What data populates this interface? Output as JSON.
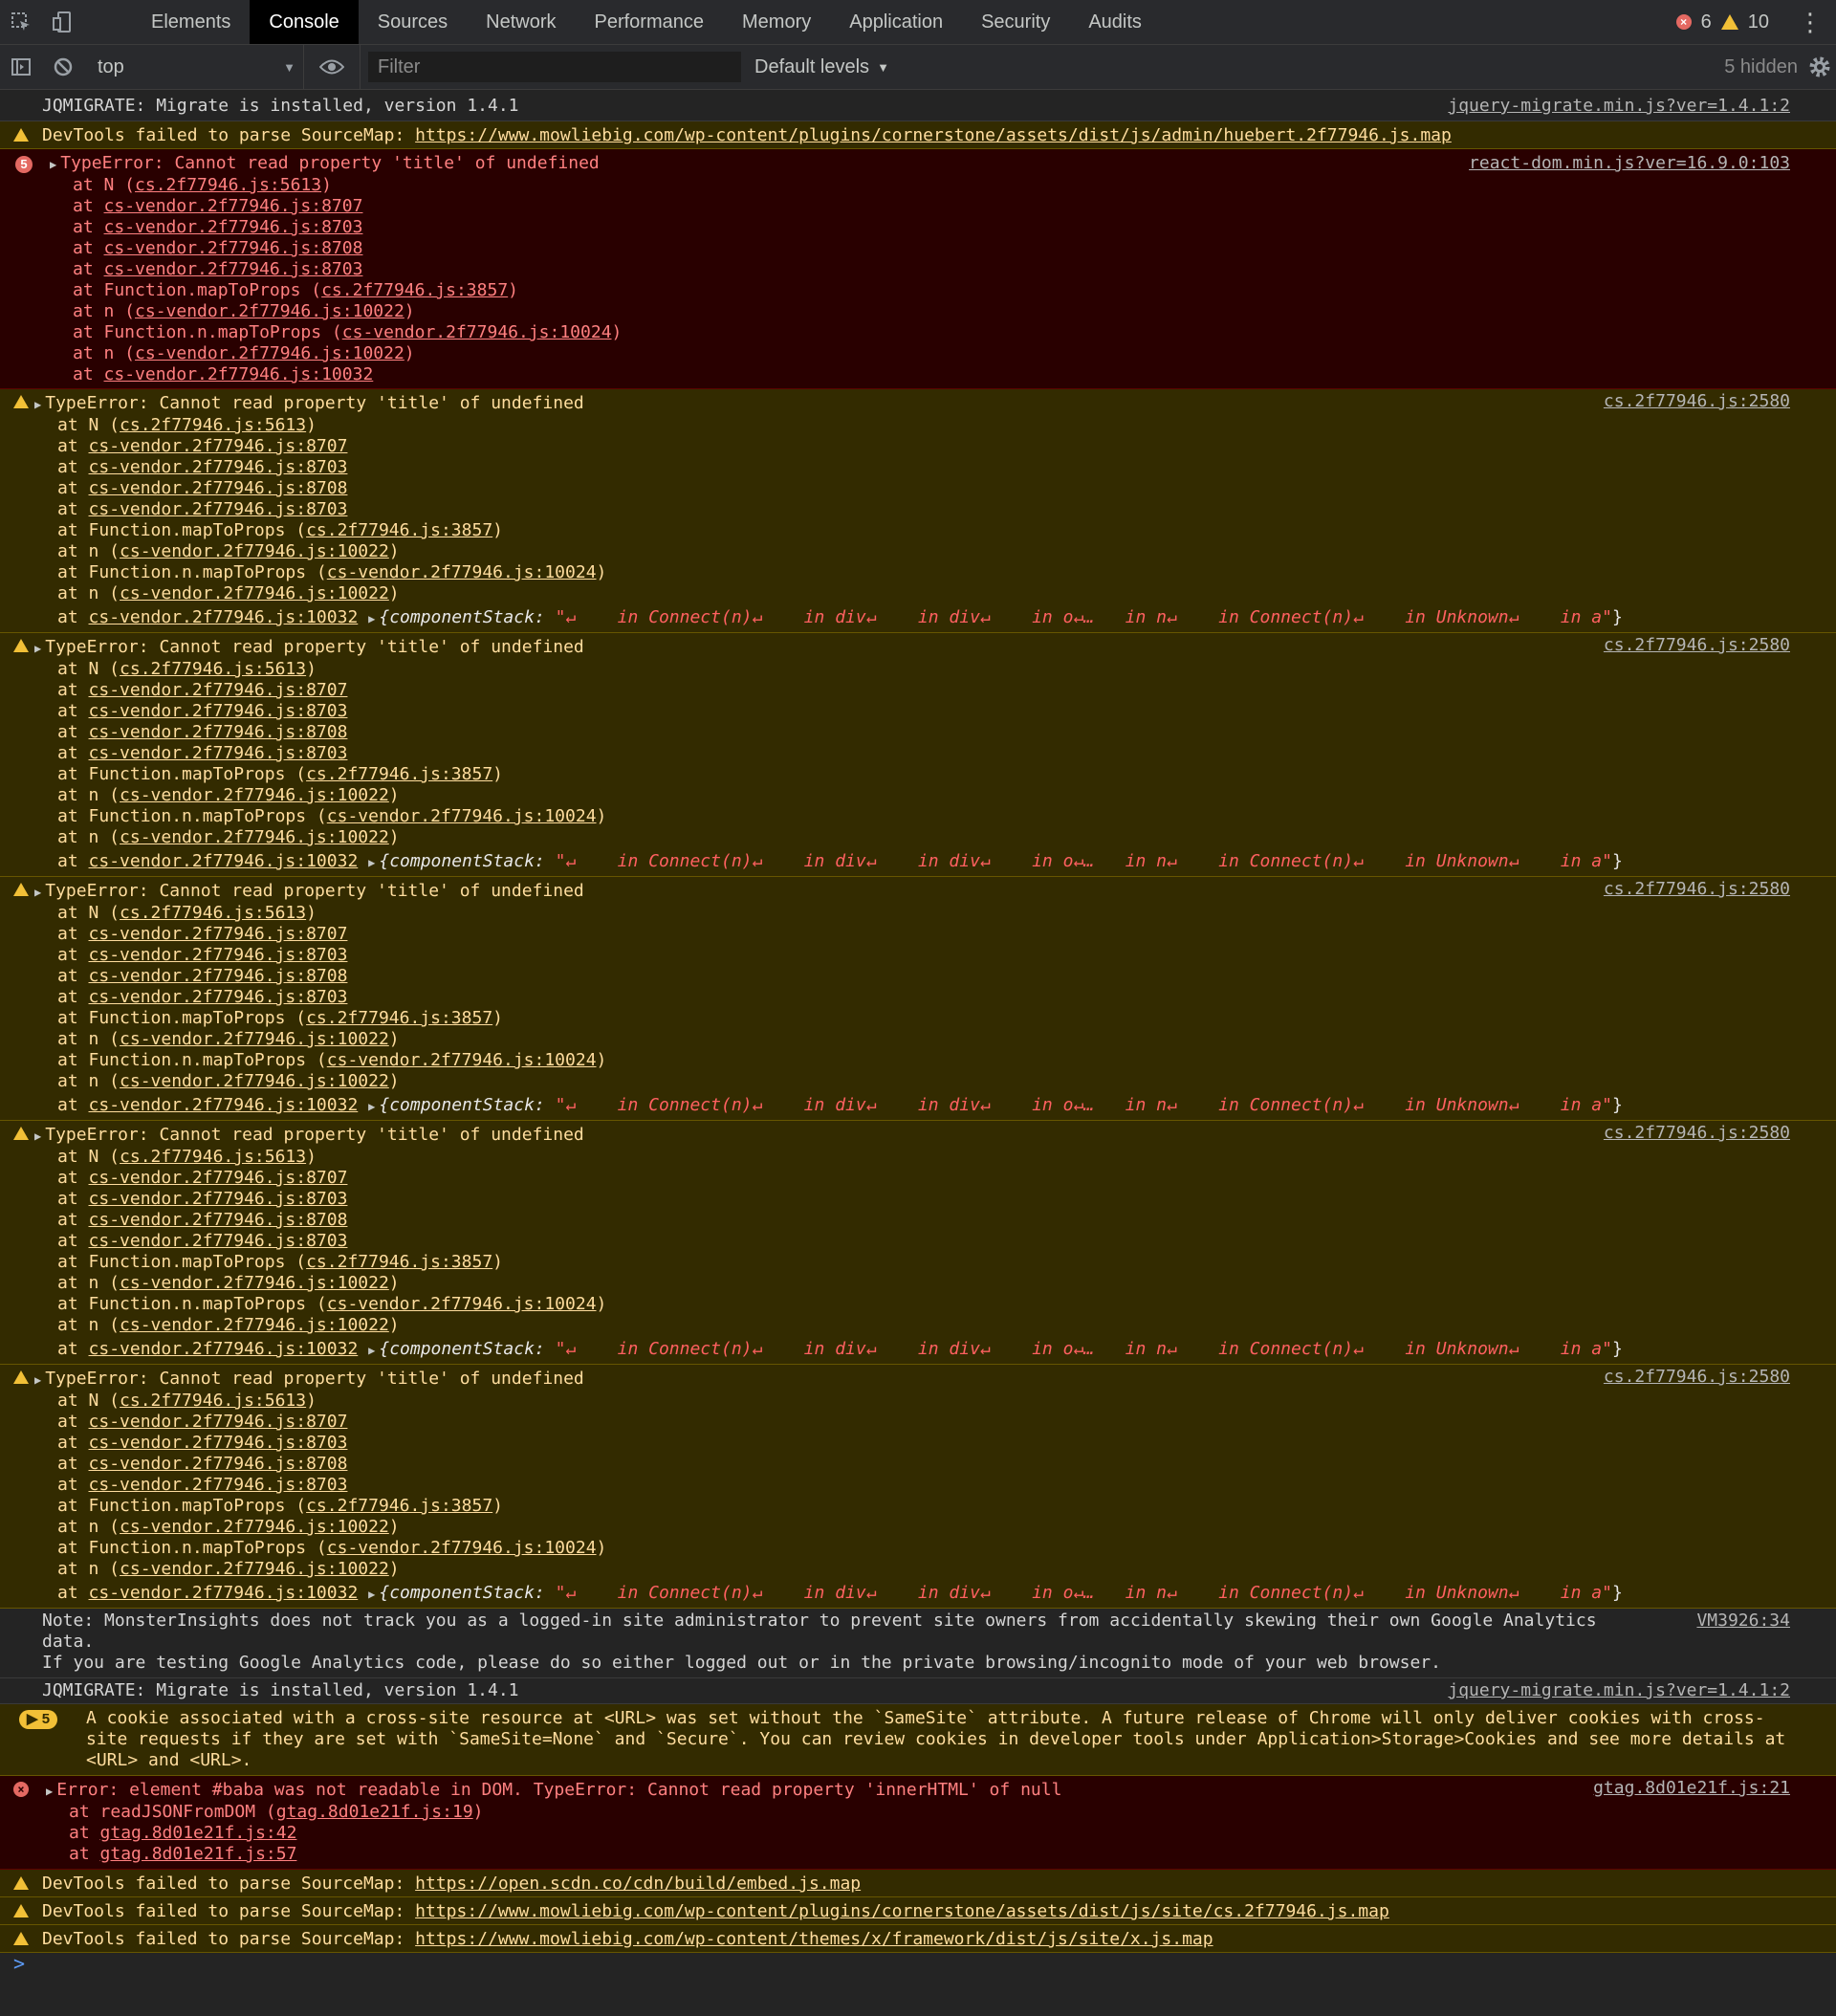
{
  "tabs": [
    "Elements",
    "Console",
    "Sources",
    "Network",
    "Performance",
    "Memory",
    "Application",
    "Security",
    "Audits"
  ],
  "counts": {
    "errors": "6",
    "warnings": "10"
  },
  "toolbar": {
    "context": "top",
    "filter_placeholder": "Filter",
    "levels": "Default levels",
    "hidden": "5 hidden"
  },
  "colors": {
    "warn_bg": "#332b00",
    "error_bg": "#290000",
    "error_text": "#ff8080",
    "warn_text": "#ffdd9e",
    "accent": "#f2c037"
  },
  "messages": {
    "m1": {
      "text": "JQMIGRATE: Migrate is installed, version 1.4.1",
      "src": "jquery-migrate.min.js?ver=1.4.1:2"
    },
    "m2": {
      "text": "DevTools failed to parse SourceMap: ",
      "url": "https://www.mowliebig.com/wp-content/plugins/cornerstone/assets/dist/js/admin/huebert.2f77946.js.map"
    },
    "m3": {
      "badge": "5",
      "text": "TypeError: Cannot read property 'title' of undefined",
      "src": "react-dom.min.js?ver=16.9.0:103",
      "frames": [
        [
          "at N (",
          "cs.2f77946.js:5613",
          ")"
        ],
        [
          "at ",
          "cs-vendor.2f77946.js:8707",
          ""
        ],
        [
          "at ",
          "cs-vendor.2f77946.js:8703",
          ""
        ],
        [
          "at ",
          "cs-vendor.2f77946.js:8708",
          ""
        ],
        [
          "at ",
          "cs-vendor.2f77946.js:8703",
          ""
        ],
        [
          "at Function.mapToProps (",
          "cs.2f77946.js:3857",
          ")"
        ],
        [
          "at n (",
          "cs-vendor.2f77946.js:10022",
          ")"
        ],
        [
          "at Function.n.mapToProps (",
          "cs-vendor.2f77946.js:10024",
          ")"
        ],
        [
          "at n (",
          "cs-vendor.2f77946.js:10022",
          ")"
        ],
        [
          "at ",
          "cs-vendor.2f77946.js:10032",
          ""
        ]
      ]
    },
    "warn_block": {
      "text": "TypeError: Cannot read property 'title' of undefined",
      "src": "cs.2f77946.js:2580",
      "frames": [
        [
          "at N (",
          "cs.2f77946.js:5613",
          ")"
        ],
        [
          "at ",
          "cs-vendor.2f77946.js:8707",
          ""
        ],
        [
          "at ",
          "cs-vendor.2f77946.js:8703",
          ""
        ],
        [
          "at ",
          "cs-vendor.2f77946.js:8708",
          ""
        ],
        [
          "at ",
          "cs-vendor.2f77946.js:8703",
          ""
        ],
        [
          "at Function.mapToProps (",
          "cs.2f77946.js:3857",
          ")"
        ],
        [
          "at n (",
          "cs-vendor.2f77946.js:10022",
          ")"
        ],
        [
          "at Function.n.mapToProps (",
          "cs-vendor.2f77946.js:10024",
          ")"
        ],
        [
          "at n (",
          "cs-vendor.2f77946.js:10022",
          ")"
        ]
      ],
      "last_prefix": "at ",
      "last_link": "cs-vendor.2f77946.js:10032",
      "cs_key": "{componentStack: ",
      "cs_value": "\"↵    in Connect(n)↵    in div↵    in div↵    in o↵…   in n↵    in Connect(n)↵    in Unknown↵    in a\"",
      "cs_close": "}"
    },
    "note": {
      "line1": "Note: MonsterInsights does not track you as a logged-in site administrator to prevent site owners from accidentally skewing their own Google Analytics data.",
      "line2": "If you are testing Google Analytics code, please do so either logged out or in the private browsing/incognito mode of your web browser.",
      "src": "VM3926:34"
    },
    "m_jq2": {
      "text": "JQMIGRATE: Migrate is installed, version 1.4.1",
      "src": "jquery-migrate.min.js?ver=1.4.1:2"
    },
    "cookie": {
      "badge": "5",
      "text": "A cookie associated with a cross-site resource at <URL> was set without the `SameSite` attribute. A future release of Chrome will only deliver cookies with cross-site requests if they are set with `SameSite=None` and `Secure`. You can review cookies in developer tools under Application>Storage>Cookies and see more details at <URL> and <URL>."
    },
    "gtag": {
      "text": "Error: element #baba was not readable in DOM. TypeError: Cannot read property 'innerHTML' of null",
      "src": "gtag.8d01e21f.js:21",
      "frames": [
        [
          "at readJSONFromDOM (",
          "gtag.8d01e21f.js:19",
          ")"
        ],
        [
          "at ",
          "gtag.8d01e21f.js:42",
          ""
        ],
        [
          "at ",
          "gtag.8d01e21f.js:57",
          ""
        ]
      ]
    },
    "sm1": {
      "text": "DevTools failed to parse SourceMap: ",
      "url": "https://open.scdn.co/cdn/build/embed.js.map"
    },
    "sm2": {
      "text": "DevTools failed to parse SourceMap: ",
      "url": "https://www.mowliebig.com/wp-content/plugins/cornerstone/assets/dist/js/site/cs.2f77946.js.map"
    },
    "sm3": {
      "text": "DevTools failed to parse SourceMap: ",
      "url": "https://www.mowliebig.com/wp-content/themes/x/framework/dist/js/site/x.js.map"
    }
  },
  "prompt": ">"
}
